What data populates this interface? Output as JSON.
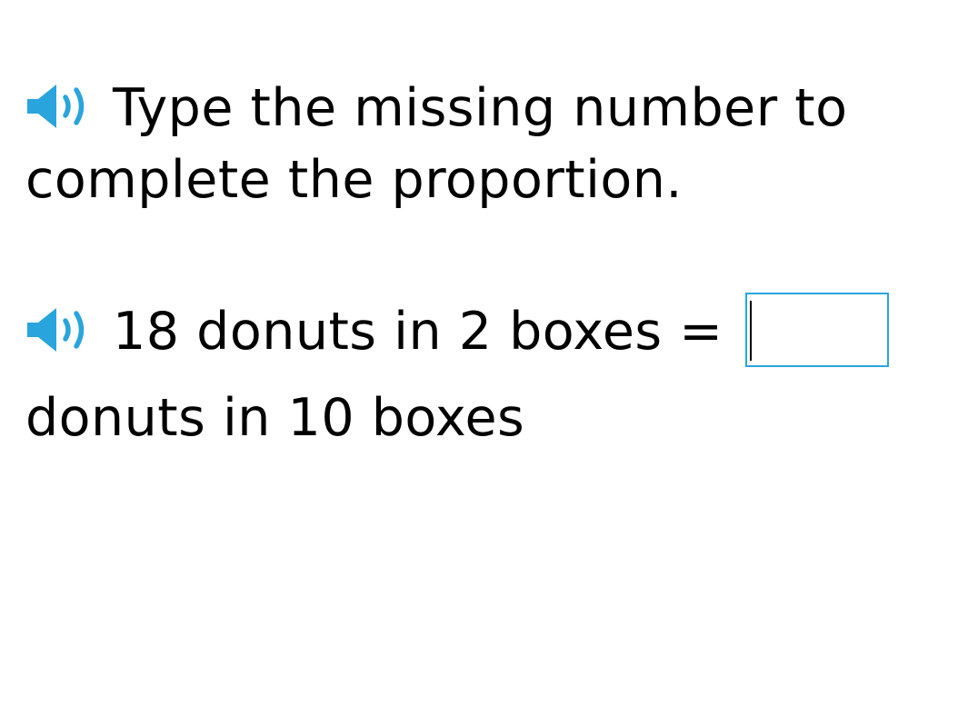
{
  "colors": {
    "accent": "#2aa4dc",
    "text": "#000000",
    "background": "#ffffff"
  },
  "icons": {
    "audio": "speaker-icon"
  },
  "instruction": {
    "line1": "Type the missing number to",
    "line2": "complete the proportion."
  },
  "question": {
    "line1": "18 donuts in 2 boxes =",
    "line2": "donuts in 10 boxes",
    "answer_value": ""
  }
}
